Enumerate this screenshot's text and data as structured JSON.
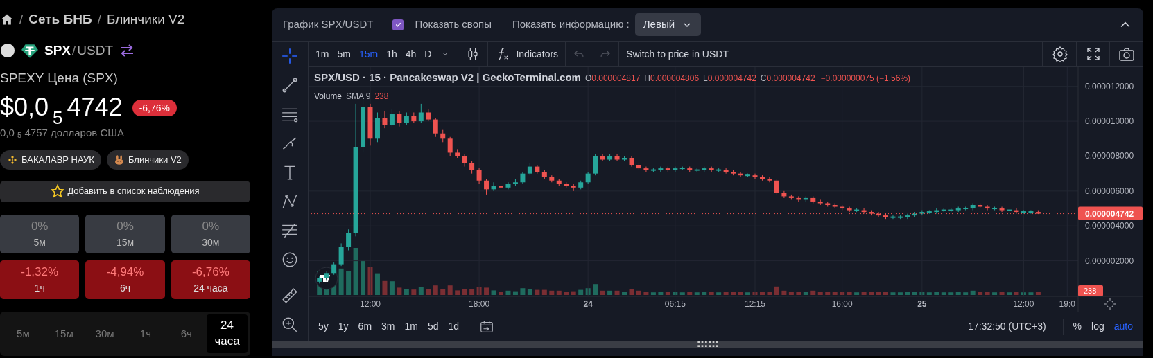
{
  "breadcrumb": [
    {
      "separator": "/",
      "label": "Сеть БНБ"
    },
    {
      "separator": "/",
      "label": "Блинчики V2"
    }
  ],
  "pair": {
    "base": "SPX",
    "separator": "/",
    "quote": "USDT"
  },
  "price_title": "SPEXY Цена (SPX)",
  "price": {
    "prefix": "$0,0",
    "subscript": "5",
    "digits": "4742",
    "change": "-6,76%"
  },
  "price_usd": "0,0 $_{5}$ 4757 долларов США",
  "chips": [
    {
      "label": "БАКАЛАВР НАУК",
      "kind": "bnb"
    },
    {
      "label": "Блинчики V2",
      "kind": "pancake"
    }
  ],
  "watch_button": "Добавить в список наблюдения",
  "stats": [
    {
      "value": "0%",
      "period": "5м",
      "down": false
    },
    {
      "value": "0%",
      "period": "15м",
      "down": false
    },
    {
      "value": "0%",
      "period": "30м",
      "down": false
    },
    {
      "value": "-1,32%",
      "period": "1ч",
      "down": true
    },
    {
      "value": "-4,94%",
      "period": "6ч",
      "down": true
    },
    {
      "value": "-6,76%",
      "period": "24 часа",
      "down": true
    }
  ],
  "timeframe_tabs": [
    {
      "label": "5м",
      "selected": false
    },
    {
      "label": "15м",
      "selected": false
    },
    {
      "label": "30м",
      "selected": false
    },
    {
      "label": "1ч",
      "selected": false
    },
    {
      "label": "6ч",
      "selected": false
    },
    {
      "label": "24 часа",
      "selected": true
    }
  ],
  "chart_panel": {
    "title": "График SPX/USDT",
    "show_swaps": {
      "label": "Показать свопы",
      "checked": true
    },
    "info_label": "Показать информацию :",
    "info_select": "Левый",
    "tools": [
      {
        "kind": "crosshair",
        "selected": true
      },
      {
        "kind": "line",
        "selected": false
      },
      {
        "kind": "hlines",
        "selected": false
      },
      {
        "kind": "brush",
        "selected": false
      },
      {
        "kind": "text",
        "selected": false
      },
      {
        "kind": "pattern",
        "selected": false
      },
      {
        "kind": "fib",
        "selected": false
      },
      {
        "kind": "emoji",
        "selected": false
      },
      {
        "kind": "ruler",
        "selected": false
      },
      {
        "kind": "zoom",
        "selected": false
      }
    ],
    "intervals": [
      {
        "label": "1m",
        "selected": false
      },
      {
        "label": "5m",
        "selected": false
      },
      {
        "label": "15m",
        "selected": true
      },
      {
        "label": "1h",
        "selected": false
      },
      {
        "label": "4h",
        "selected": false
      },
      {
        "label": "D",
        "selected": false
      }
    ],
    "indicators_button": "Indicators",
    "switch_button": "Switch to price in USDT",
    "legend": {
      "symbol": "SPX/USD · 15 · Pancakeswap V2 | GeckoTerminal.com",
      "ohlc": [
        {
          "key": "O",
          "value": "0.000004817"
        },
        {
          "key": "H",
          "value": "0.000004806"
        },
        {
          "key": "L",
          "value": "0.000004742"
        },
        {
          "key": "C",
          "value": "0.000004742"
        }
      ],
      "change": "−0.000000075 (−1.56%)"
    },
    "volume_legend": {
      "name": "Volume",
      "sma": "SMA 9",
      "value": "238"
    },
    "volume_label": "238",
    "price_label": "0.000004742",
    "chart_data": {
      "type": "candlestick",
      "grid": true,
      "ylim": [
        0,
        1.31e-05
      ],
      "yticks": [
        {
          "value": 2e-06,
          "label": "0.000002000"
        },
        {
          "value": 4e-06,
          "label": "0.000004000"
        },
        {
          "value": 6e-06,
          "label": "0.000006000"
        },
        {
          "value": 8e-06,
          "label": "0.000008000"
        },
        {
          "value": 1e-05,
          "label": "0.000010000"
        },
        {
          "value": 1.2e-05,
          "label": "0.000012000"
        }
      ],
      "categories": [
        null,
        null,
        null,
        null,
        null,
        null,
        null,
        null,
        "12:00",
        null,
        null,
        null,
        null,
        null,
        null,
        null,
        null,
        null,
        null,
        null,
        null,
        null,
        null,
        "18:00",
        null,
        null,
        null,
        null,
        null,
        null,
        null,
        null,
        null,
        null,
        null,
        null,
        null,
        null,
        "24",
        null,
        null,
        null,
        null,
        null,
        null,
        null,
        null,
        null,
        null,
        null,
        "06:15",
        null,
        null,
        null,
        null,
        null,
        null,
        null,
        null,
        null,
        null,
        "12:15",
        null,
        null,
        null,
        null,
        null,
        null,
        null,
        null,
        null,
        null,
        null,
        "16:00",
        null,
        null,
        null,
        null,
        null,
        null,
        null,
        null,
        null,
        null,
        "25",
        null,
        null,
        null,
        null,
        null,
        null,
        null,
        null,
        null,
        null,
        null,
        null,
        null,
        "12:00",
        null,
        null,
        null,
        null,
        null,
        "19:0",
        null
      ],
      "ohlc": [
        null,
        [
          8e-07,
          1.1e-06,
          7e-07,
          1e-06
        ],
        [
          1e-06,
          1.4e-06,
          9e-07,
          1.3e-06
        ],
        [
          1.3e-06,
          1.9e-06,
          1.2e-06,
          1.8e-06
        ],
        [
          1.8e-06,
          3e-06,
          1.7e-06,
          2.8e-06
        ],
        [
          2.8e-06,
          3.8e-06,
          2.6e-06,
          3.6e-06
        ],
        [
          3.6e-06,
          1.1e-05,
          3.4e-06,
          8.5e-06
        ],
        [
          8.5e-06,
          1.12e-05,
          8.2e-06,
          1.08e-05
        ],
        [
          1.08e-05,
          1.1e-05,
          8.6e-06,
          9e-06
        ],
        [
          9e-06,
          1.05e-05,
          8.8e-06,
          1.02e-05
        ],
        [
          1.02e-05,
          1.06e-05,
          9.6e-06,
          9.8e-06
        ],
        [
          9.8e-06,
          1.07e-05,
          9.7e-06,
          1.04e-05
        ],
        [
          1.04e-05,
          1.06e-05,
          9.7e-06,
          9.9e-06
        ],
        [
          9.9e-06,
          1.05e-05,
          9.8e-06,
          1.03e-05
        ],
        [
          1.03e-05,
          1.05e-05,
          9.9e-06,
          1e-05
        ],
        [
          1e-05,
          1.1e-05,
          9.9e-06,
          1.05e-05
        ],
        [
          1.05e-05,
          1.07e-05,
          1e-05,
          1.01e-05
        ],
        [
          1.01e-05,
          1.02e-05,
          9.1e-06,
          9.3e-06
        ],
        [
          9.3e-06,
          9.5e-06,
          8.8e-06,
          9e-06
        ],
        [
          9e-06,
          9.1e-06,
          8e-06,
          8.2e-06
        ],
        [
          8.2e-06,
          8.4e-06,
          7.9e-06,
          8e-06
        ],
        [
          8e-06,
          8.1e-06,
          7.4e-06,
          7.6e-06
        ],
        [
          7.6e-06,
          7.7e-06,
          7e-06,
          7.2e-06
        ],
        [
          7.2e-06,
          7.3e-06,
          6.4e-06,
          6.6e-06
        ],
        [
          6.6e-06,
          6.7e-06,
          5.8e-06,
          6.1e-06
        ],
        [
          6.1e-06,
          6.5e-06,
          6e-06,
          6.3e-06
        ],
        [
          6.3e-06,
          6.4e-06,
          6.1e-06,
          6.2e-06
        ],
        [
          6.2e-06,
          6.5e-06,
          6.1e-06,
          6.4e-06
        ],
        [
          6.4e-06,
          6.7e-06,
          6.3e-06,
          6.5e-06
        ],
        [
          6.5e-06,
          7.1e-06,
          6.4e-06,
          7e-06
        ],
        [
          7e-06,
          7.6e-06,
          6.9e-06,
          7.4e-06
        ],
        [
          7.4e-06,
          7.5e-06,
          7e-06,
          7.1e-06
        ],
        [
          7.1e-06,
          7.2e-06,
          6.7e-06,
          6.8e-06
        ],
        [
          6.8e-06,
          6.9e-06,
          6.5e-06,
          6.6e-06
        ],
        [
          6.6e-06,
          6.7e-06,
          6.3e-06,
          6.4e-06
        ],
        [
          6.4e-06,
          6.5e-06,
          6.2e-06,
          6.3e-06
        ],
        [
          6.3e-06,
          6.4e-06,
          6e-06,
          6.2e-06
        ],
        [
          6.2e-06,
          6.6e-06,
          6.1e-06,
          6.5e-06
        ],
        [
          6.5e-06,
          7.1e-06,
          6.4e-06,
          7e-06
        ],
        [
          7e-06,
          8.1e-06,
          6.9e-06,
          8e-06
        ],
        [
          8e-06,
          8.1e-06,
          7.7e-06,
          7.8e-06
        ],
        [
          7.8e-06,
          8.1e-06,
          7.7e-06,
          8e-06
        ],
        [
          8e-06,
          8.1e-06,
          7.7e-06,
          7.8e-06
        ],
        [
          7.8e-06,
          8e-06,
          7.7e-06,
          7.9e-06
        ],
        [
          7.9e-06,
          8e-06,
          7.4e-06,
          7.5e-06
        ],
        [
          7.5e-06,
          7.6e-06,
          7.2e-06,
          7.3e-06
        ],
        [
          7.3e-06,
          7.4e-06,
          7.1e-06,
          7.2e-06
        ],
        [
          7.2e-06,
          7.3e-06,
          7.1e-06,
          7.2e-06
        ],
        [
          7.2e-06,
          7.4e-06,
          7.1e-06,
          7.3e-06
        ],
        [
          7.3e-06,
          7.4e-06,
          7.1e-06,
          7.2e-06
        ],
        [
          7.2e-06,
          7.4e-06,
          7.1e-06,
          7.3e-06
        ],
        [
          7.3e-06,
          7.4e-06,
          7.2e-06,
          7.3e-06
        ],
        [
          7.3e-06,
          7.4e-06,
          7.1e-06,
          7.2e-06
        ],
        [
          7.2e-06,
          7.3e-06,
          7.1e-06,
          7.2e-06
        ],
        [
          7.2e-06,
          7.4e-06,
          7.1e-06,
          7.3e-06
        ],
        [
          7.3e-06,
          7.4e-06,
          7.1e-06,
          7.2e-06
        ],
        [
          7.2e-06,
          7.3e-06,
          7.1e-06,
          7.2e-06
        ],
        [
          7.2e-06,
          7.3e-06,
          7e-06,
          7.1e-06
        ],
        [
          7.1e-06,
          7.2e-06,
          6.9e-06,
          7e-06
        ],
        [
          7e-06,
          7.1e-06,
          6.8e-06,
          6.9e-06
        ],
        [
          6.9e-06,
          7e-06,
          6.8e-06,
          6.9e-06
        ],
        [
          6.9e-06,
          7e-06,
          6.7e-06,
          6.8e-06
        ],
        [
          6.8e-06,
          6.9e-06,
          6.6e-06,
          6.7e-06
        ],
        [
          6.7e-06,
          6.8e-06,
          6.5e-06,
          6.6e-06
        ],
        [
          6.6e-06,
          6.7e-06,
          5.8e-06,
          5.9e-06
        ],
        [
          5.9e-06,
          6e-06,
          5.6e-06,
          5.7e-06
        ],
        [
          5.7e-06,
          5.8e-06,
          5.5e-06,
          5.6e-06
        ],
        [
          5.6e-06,
          5.7e-06,
          5.4e-06,
          5.5e-06
        ],
        [
          5.5e-06,
          5.7e-06,
          5.4e-06,
          5.6e-06
        ],
        [
          5.6e-06,
          5.7e-06,
          5.3e-06,
          5.4e-06
        ],
        [
          5.4e-06,
          5.5e-06,
          5.2e-06,
          5.3e-06
        ],
        [
          5.3e-06,
          5.4e-06,
          5.1e-06,
          5.2e-06
        ],
        [
          5.2e-06,
          5.3e-06,
          5e-06,
          5.1e-06
        ],
        [
          5.1e-06,
          5.2e-06,
          4.9e-06,
          5e-06
        ],
        [
          5e-06,
          5.1e-06,
          4.8e-06,
          4.9e-06
        ],
        [
          4.9e-06,
          5e-06,
          4.8e-06,
          4.9e-06
        ],
        [
          4.9e-06,
          5e-06,
          4.7e-06,
          4.8e-06
        ],
        [
          4.8e-06,
          4.9e-06,
          4.6e-06,
          4.7e-06
        ],
        [
          4.7e-06,
          4.8e-06,
          4.5e-06,
          4.6e-06
        ],
        [
          4.6e-06,
          4.7e-06,
          4.4e-06,
          4.5e-06
        ],
        [
          4.5e-06,
          4.6e-06,
          4.4e-06,
          4.5e-06
        ],
        [
          4.5e-06,
          4.6e-06,
          4.4e-06,
          4.5e-06
        ],
        [
          4.5e-06,
          4.7e-06,
          4.4e-06,
          4.6e-06
        ],
        [
          4.6e-06,
          4.8e-06,
          4.5e-06,
          4.7e-06
        ],
        [
          4.7e-06,
          4.9e-06,
          4.6e-06,
          4.8e-06
        ],
        [
          4.8e-06,
          4.9e-06,
          4.7e-06,
          4.8e-06
        ],
        [
          4.8e-06,
          5e-06,
          4.7e-06,
          4.9e-06
        ],
        [
          4.9e-06,
          5e-06,
          4.8e-06,
          4.9e-06
        ],
        [
          4.9e-06,
          5e-06,
          4.8e-06,
          4.9e-06
        ],
        [
          4.9e-06,
          5.1e-06,
          4.8e-06,
          5e-06
        ],
        [
          5e-06,
          5.1e-06,
          4.9e-06,
          5e-06
        ],
        [
          5e-06,
          5.3e-06,
          4.9e-06,
          5.2e-06
        ],
        [
          5.2e-06,
          5.3e-06,
          5e-06,
          5.1e-06
        ],
        [
          5.1e-06,
          5.2e-06,
          4.9e-06,
          5e-06
        ],
        [
          5e-06,
          5.1e-06,
          4.9e-06,
          5e-06
        ],
        [
          5e-06,
          5.1e-06,
          4.8e-06,
          4.9e-06
        ],
        [
          4.9e-06,
          5e-06,
          4.8e-06,
          4.9e-06
        ],
        [
          4.9e-06,
          5e-06,
          4.7e-06,
          4.8e-06
        ],
        [
          4.8e-06,
          4.9e-06,
          4.7e-06,
          4.8e-06
        ],
        [
          4.8e-06,
          4.9e-06,
          4.7e-06,
          4.8e-06
        ],
        [
          4.8e-06,
          4.9e-06,
          4.7e-06,
          4.7e-06
        ],
        null,
        null,
        null,
        null,
        null
      ]
    },
    "ranges": [
      "5y",
      "1y",
      "6m",
      "3m",
      "1m",
      "5d",
      "1d"
    ],
    "clock": "17:32:50 (UTC+3)",
    "scale_buttons": [
      {
        "label": "%",
        "selected": false
      },
      {
        "label": "log",
        "selected": false
      },
      {
        "label": "auto",
        "selected": true
      }
    ]
  }
}
